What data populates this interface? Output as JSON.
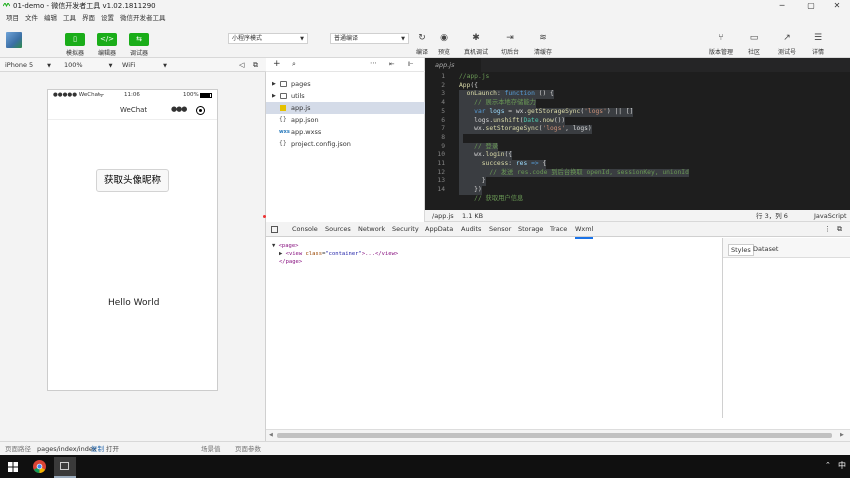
{
  "window": {
    "title": "01-demo - 微信开发者工具 v1.02.1811290",
    "min": "─",
    "max": "▢",
    "close": "✕"
  },
  "menu": [
    "项目",
    "文件",
    "编辑",
    "工具",
    "界面",
    "设置",
    "微信开发者工具"
  ],
  "toolbar": {
    "simulator": "模拟器",
    "editor": "编辑器",
    "debugger": "调试器",
    "mode_select": "小程序模式",
    "compile_select": "普通编译",
    "compile": "编译",
    "preview": "预览",
    "remote_debug": "真机调试",
    "background": "切后台",
    "clear_cache": "清缓存",
    "version": "版本管理",
    "community": "社区",
    "test": "测试号",
    "details": "详情"
  },
  "sim_toolbar": {
    "device": "iPhone 5",
    "zoom": "100%",
    "network": "WiFi"
  },
  "phone": {
    "carrier": "●●●●● WeChat",
    "time": "11:06",
    "battery": "100%",
    "nav_title": "WeChat",
    "avatar_button": "获取头像昵称",
    "hello": "Hello World"
  },
  "filetree": {
    "items": [
      {
        "name": "pages",
        "type": "folder"
      },
      {
        "name": "utils",
        "type": "folder"
      },
      {
        "name": "app.js",
        "type": "js"
      },
      {
        "name": "app.json",
        "type": "json"
      },
      {
        "name": "app.wxss",
        "type": "wxss"
      },
      {
        "name": "project.config.json",
        "type": "json"
      }
    ]
  },
  "editor": {
    "tab": "app.js",
    "line_numbers": [
      "1",
      "2",
      "3",
      "4",
      "5",
      "6",
      "7",
      "8",
      "9",
      "10",
      "11",
      "12",
      "13",
      "14"
    ],
    "path": "/app.js",
    "size": "1.1 KB",
    "position": "行 3，列 6",
    "language": "JavaScript"
  },
  "devtools": {
    "tabs": [
      "Console",
      "Sources",
      "Network",
      "Security",
      "AppData",
      "Audits",
      "Sensor",
      "Storage",
      "Trace",
      "Wxml"
    ],
    "active_tab": "Wxml",
    "side_tabs": [
      "Styles",
      "Dataset"
    ],
    "page_open": "<page>",
    "view_tag": "view",
    "view_attr": "class",
    "view_val": "\"container\"",
    "view_rest": ">...</view>",
    "page_close": "</page>"
  },
  "statusbar": {
    "path_label": "页面路径",
    "path": "pages/index/index",
    "copy": "复制",
    "open": "打开",
    "scene": "场景值",
    "params": "页面参数"
  },
  "taskbar": {
    "ime": "中"
  }
}
